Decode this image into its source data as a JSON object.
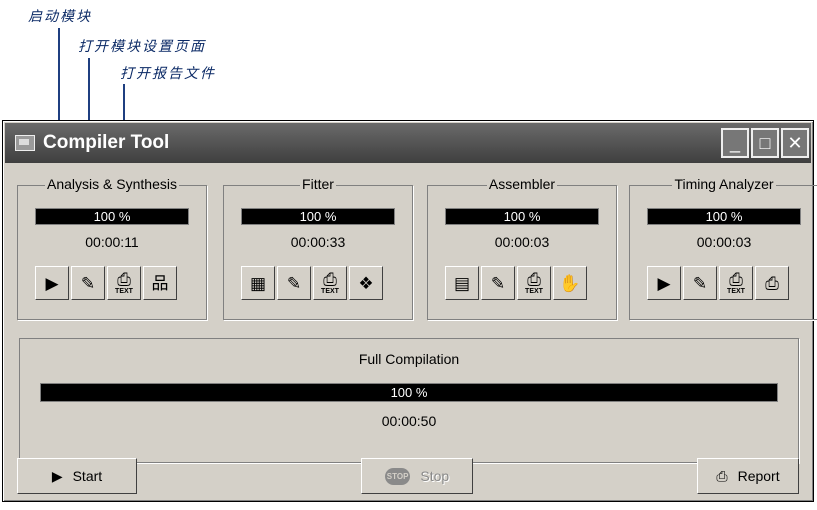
{
  "annotations": {
    "start_module": "启动模块",
    "open_module_settings": "打开模块设置页面",
    "open_report_file": "打开报告文件"
  },
  "window": {
    "title": "Compiler Tool",
    "controls": [
      "minimize-icon",
      "maximize-icon",
      "close-icon"
    ]
  },
  "modules": [
    {
      "name": "Analysis & Synthesis",
      "progress": "100 %",
      "progress_value": 100,
      "time": "00:00:11",
      "tools": [
        {
          "icon": "start-module-icon",
          "glyph": "▶"
        },
        {
          "icon": "settings-pencil-icon",
          "glyph": "✎"
        },
        {
          "icon": "report-text-icon",
          "glyph": "⎙",
          "caption": "TEXT"
        },
        {
          "icon": "hierarchy-icon",
          "glyph": "品"
        }
      ]
    },
    {
      "name": "Fitter",
      "progress": "100 %",
      "progress_value": 100,
      "time": "00:00:33",
      "tools": [
        {
          "icon": "start-module-icon",
          "glyph": "▦"
        },
        {
          "icon": "settings-pencil-icon",
          "glyph": "✎"
        },
        {
          "icon": "report-text-icon",
          "glyph": "⎙",
          "caption": "TEXT"
        },
        {
          "icon": "floorplan-icon",
          "glyph": "❖"
        }
      ]
    },
    {
      "name": "Assembler",
      "progress": "100 %",
      "progress_value": 100,
      "time": "00:00:03",
      "tools": [
        {
          "icon": "start-module-icon",
          "glyph": "▤"
        },
        {
          "icon": "settings-pencil-icon",
          "glyph": "✎"
        },
        {
          "icon": "report-text-icon",
          "glyph": "⎙",
          "caption": "TEXT"
        },
        {
          "icon": "programmer-icon",
          "glyph": "✋"
        }
      ]
    },
    {
      "name": "Timing Analyzer",
      "progress": "100 %",
      "progress_value": 100,
      "time": "00:00:03",
      "tools": [
        {
          "icon": "start-module-icon",
          "glyph": "▶"
        },
        {
          "icon": "settings-pencil-icon",
          "glyph": "✎"
        },
        {
          "icon": "report-text-icon",
          "glyph": "⎙",
          "caption": "TEXT"
        },
        {
          "icon": "report-icon",
          "glyph": "⎙"
        }
      ]
    }
  ],
  "full_compilation": {
    "label": "Full Compilation",
    "progress": "100 %",
    "progress_value": 100,
    "time": "00:00:50"
  },
  "buttons": {
    "start": "Start",
    "stop": "Stop",
    "stop_badge": "STOP",
    "report": "Report"
  },
  "colors": {
    "face": "#d4d0c8",
    "titlebar": "#4a4a4a",
    "progress_fill": "#000000",
    "annotation": "#0b2a66"
  }
}
